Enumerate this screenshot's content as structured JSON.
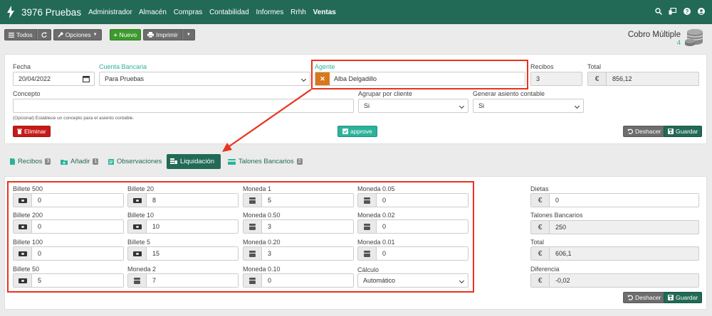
{
  "topbar": {
    "brand": "3976 Pruebas",
    "nav": [
      "Administrador",
      "Almacén",
      "Compras",
      "Contabilidad",
      "Informes",
      "Rrhh",
      "Ventas"
    ],
    "active_nav": "Ventas",
    "icons": [
      "search-icon",
      "monitor-icon",
      "help-icon",
      "user-icon"
    ]
  },
  "toolbar": {
    "todos": "Todos",
    "opciones": "Opciones",
    "nuevo": "Nuevo",
    "imprimir": "Imprimir"
  },
  "header": {
    "title": "Cobro Múltiple",
    "count": "4"
  },
  "form": {
    "fecha_label": "Fecha",
    "fecha_value": "20/04/2022",
    "cuenta_label": "Cuenta Bancaria",
    "cuenta_value": "Para Pruebas",
    "agente_label": "Agente",
    "agente_value": "Alba Delgadillo",
    "recibos_label": "Recibos",
    "recibos_value": "3",
    "total_label": "Total",
    "total_value": "856,12",
    "concepto_label": "Concepto",
    "concepto_value": "",
    "concepto_hint": "(Opcional) Establece un concepto para el asiento contable.",
    "agrupar_label": "Agrupar por cliente",
    "agrupar_value": "Si",
    "generar_label": "Generar asiento contable",
    "generar_value": "Si",
    "eliminar": "Eliminar",
    "approve": "approve",
    "deshacer": "Deshacer",
    "guardar": "Guardar"
  },
  "tabs": [
    {
      "label": "Recibos",
      "badge": "3"
    },
    {
      "label": "Añadir",
      "badge": "1"
    },
    {
      "label": "Observaciones",
      "badge": ""
    },
    {
      "label": "Liquidación",
      "badge": ""
    },
    {
      "label": "Talones Bancarios",
      "badge": "2"
    }
  ],
  "active_tab": "Liquidación",
  "liquidacion": {
    "fields": [
      {
        "label": "Billete 500",
        "value": "0",
        "icon": "banknote-icon"
      },
      {
        "label": "Billete 20",
        "value": "8",
        "icon": "banknote-icon"
      },
      {
        "label": "Moneda 1",
        "value": "5",
        "icon": "coins-icon"
      },
      {
        "label": "Moneda 0.05",
        "value": "0",
        "icon": "coins-icon"
      },
      {
        "label": "Billete 200",
        "value": "0",
        "icon": "banknote-icon"
      },
      {
        "label": "Billete 10",
        "value": "10",
        "icon": "banknote-icon"
      },
      {
        "label": "Moneda 0.50",
        "value": "3",
        "icon": "coins-icon"
      },
      {
        "label": "Moneda 0.02",
        "value": "0",
        "icon": "coins-icon"
      },
      {
        "label": "Billete 100",
        "value": "0",
        "icon": "banknote-icon"
      },
      {
        "label": "Billete 5",
        "value": "15",
        "icon": "banknote-icon"
      },
      {
        "label": "Moneda 0.20",
        "value": "3",
        "icon": "coins-icon"
      },
      {
        "label": "Moneda 0.01",
        "value": "0",
        "icon": "coins-icon"
      },
      {
        "label": "Billete 50",
        "value": "5",
        "icon": "banknote-icon"
      },
      {
        "label": "Moneda 2",
        "value": "7",
        "icon": "coins-icon"
      },
      {
        "label": "Moneda 0.10",
        "value": "0",
        "icon": "coins-icon"
      }
    ],
    "calculo_label": "Cálculo",
    "calculo_value": "Automático",
    "summary": [
      {
        "label": "Dietas",
        "value": "0"
      },
      {
        "label": "Talones Bancarios",
        "value": "250"
      },
      {
        "label": "Total",
        "value": "606,1"
      },
      {
        "label": "Diferencia",
        "value": "-0,02"
      }
    ],
    "currency": "€",
    "deshacer": "Deshacer",
    "guardar": "Guardar"
  },
  "colors": {
    "brand": "#226a55",
    "accent": "#2bb39a",
    "highlight": "#e8331c",
    "danger": "#c71a1a"
  }
}
